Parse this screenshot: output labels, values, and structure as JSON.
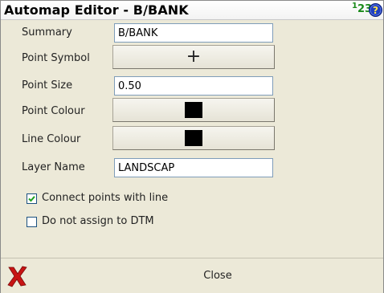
{
  "window": {
    "title": "Automap Editor - B/BANK",
    "input_mode": {
      "base": "1",
      "sub": "2",
      "tail": "3"
    }
  },
  "form": {
    "summary": {
      "label": "Summary",
      "value": "B/BANK"
    },
    "point_symbol": {
      "label": "Point Symbol",
      "value": "+"
    },
    "point_size": {
      "label": "Point Size",
      "value": "0.50"
    },
    "point_colour": {
      "label": "Point Colour",
      "color": "#000000"
    },
    "line_colour": {
      "label": "Line Colour",
      "color": "#000000"
    },
    "layer_name": {
      "label": "Layer Name",
      "value": "LANDSCAP"
    },
    "connect_points": {
      "label": "Connect points with line",
      "checked": true
    },
    "no_dtm": {
      "label": "Do not assign to DTM",
      "checked": false
    }
  },
  "footer": {
    "cancel_icon": "red-x-icon",
    "close_label": "Close"
  },
  "icons": {
    "help": "help-question-icon",
    "cancel": "red-x-icon"
  },
  "colors": {
    "accent_green": "#1a8a1a",
    "help_blue": "#1f3fbf",
    "cancel_red": "#c81414"
  }
}
